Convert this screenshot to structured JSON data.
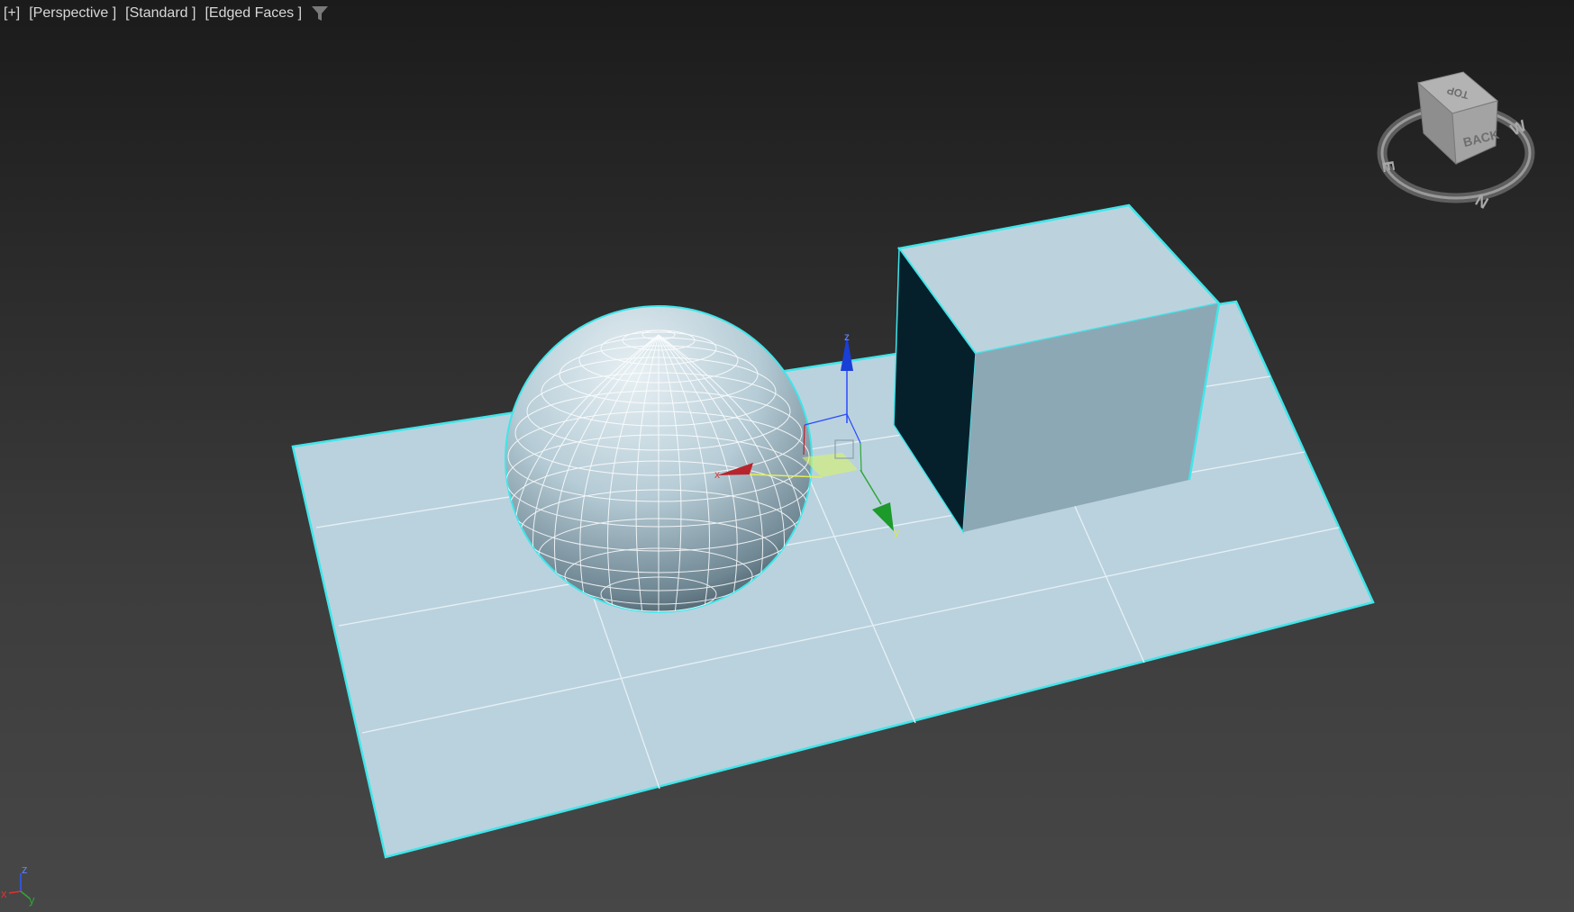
{
  "viewport": {
    "menu_label": "[+]",
    "view_label": "[Perspective ]",
    "shading_label": "[Standard ]",
    "display_label": "[Edged Faces ]",
    "filter_icon": "filter-icon"
  },
  "gizmo": {
    "x_label": "x",
    "y_label": "y",
    "z_label": "z"
  },
  "viewcube": {
    "top_face": "TOP",
    "back_face": "BACK",
    "compass": {
      "west": "W",
      "east": "E",
      "north": "N"
    }
  },
  "axis_tripod": {
    "x_label": "x",
    "y_label": "y",
    "z_label": "z"
  },
  "colors": {
    "object_fill": "#b9d1dc",
    "selection_edge": "#3fe6ea",
    "x_axis": "#c0202a",
    "y_axis": "#1c9a2a",
    "z_axis": "#1a3fd6"
  }
}
